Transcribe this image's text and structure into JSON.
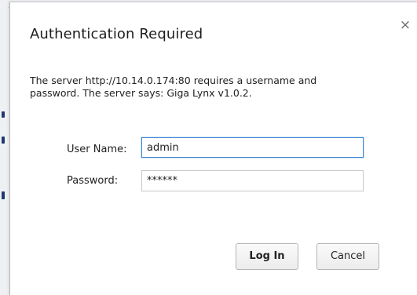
{
  "dialog": {
    "title": "Authentication Required",
    "close_glyph": "×",
    "message": "The server http://10.14.0.174:80 requires a username and password. The server says: Giga Lynx v1.0.2.",
    "username": {
      "label": "User Name:",
      "value": "admin"
    },
    "password": {
      "label": "Password:",
      "value": "******"
    },
    "buttons": {
      "login": "Log In",
      "cancel": "Cancel"
    }
  },
  "icons": {
    "close": "close-icon"
  },
  "colors": {
    "focus_border": "#3a86d4",
    "field_border": "#c6c6c6",
    "button_border": "#b5b5b5"
  }
}
